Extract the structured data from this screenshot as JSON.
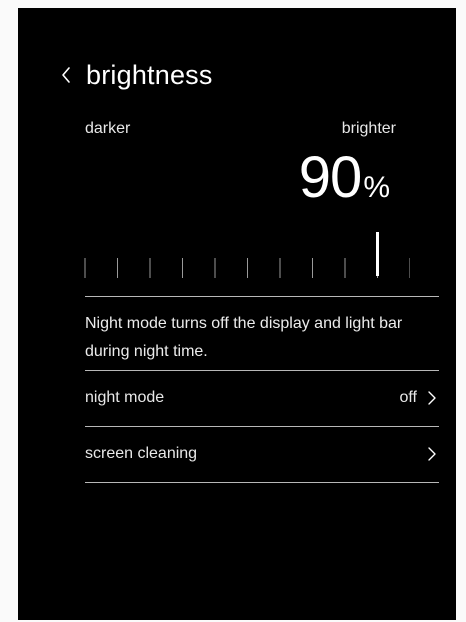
{
  "header": {
    "title": "brightness",
    "back_icon": "chevron-left-icon"
  },
  "brightness": {
    "min_label": "darker",
    "max_label": "brighter",
    "value": "90",
    "unit": "%",
    "level": 0.9,
    "tick_count": 11
  },
  "description": "Night mode turns off the display and light bar during night time.",
  "settings": [
    {
      "label": "night mode",
      "value": "off",
      "icon": "chevron-right-icon"
    },
    {
      "label": "screen cleaning",
      "value": "",
      "icon": "chevron-right-icon"
    }
  ],
  "colors": {
    "background": "#000000",
    "text": "#ffffff",
    "divider": "#b8b8b8"
  }
}
